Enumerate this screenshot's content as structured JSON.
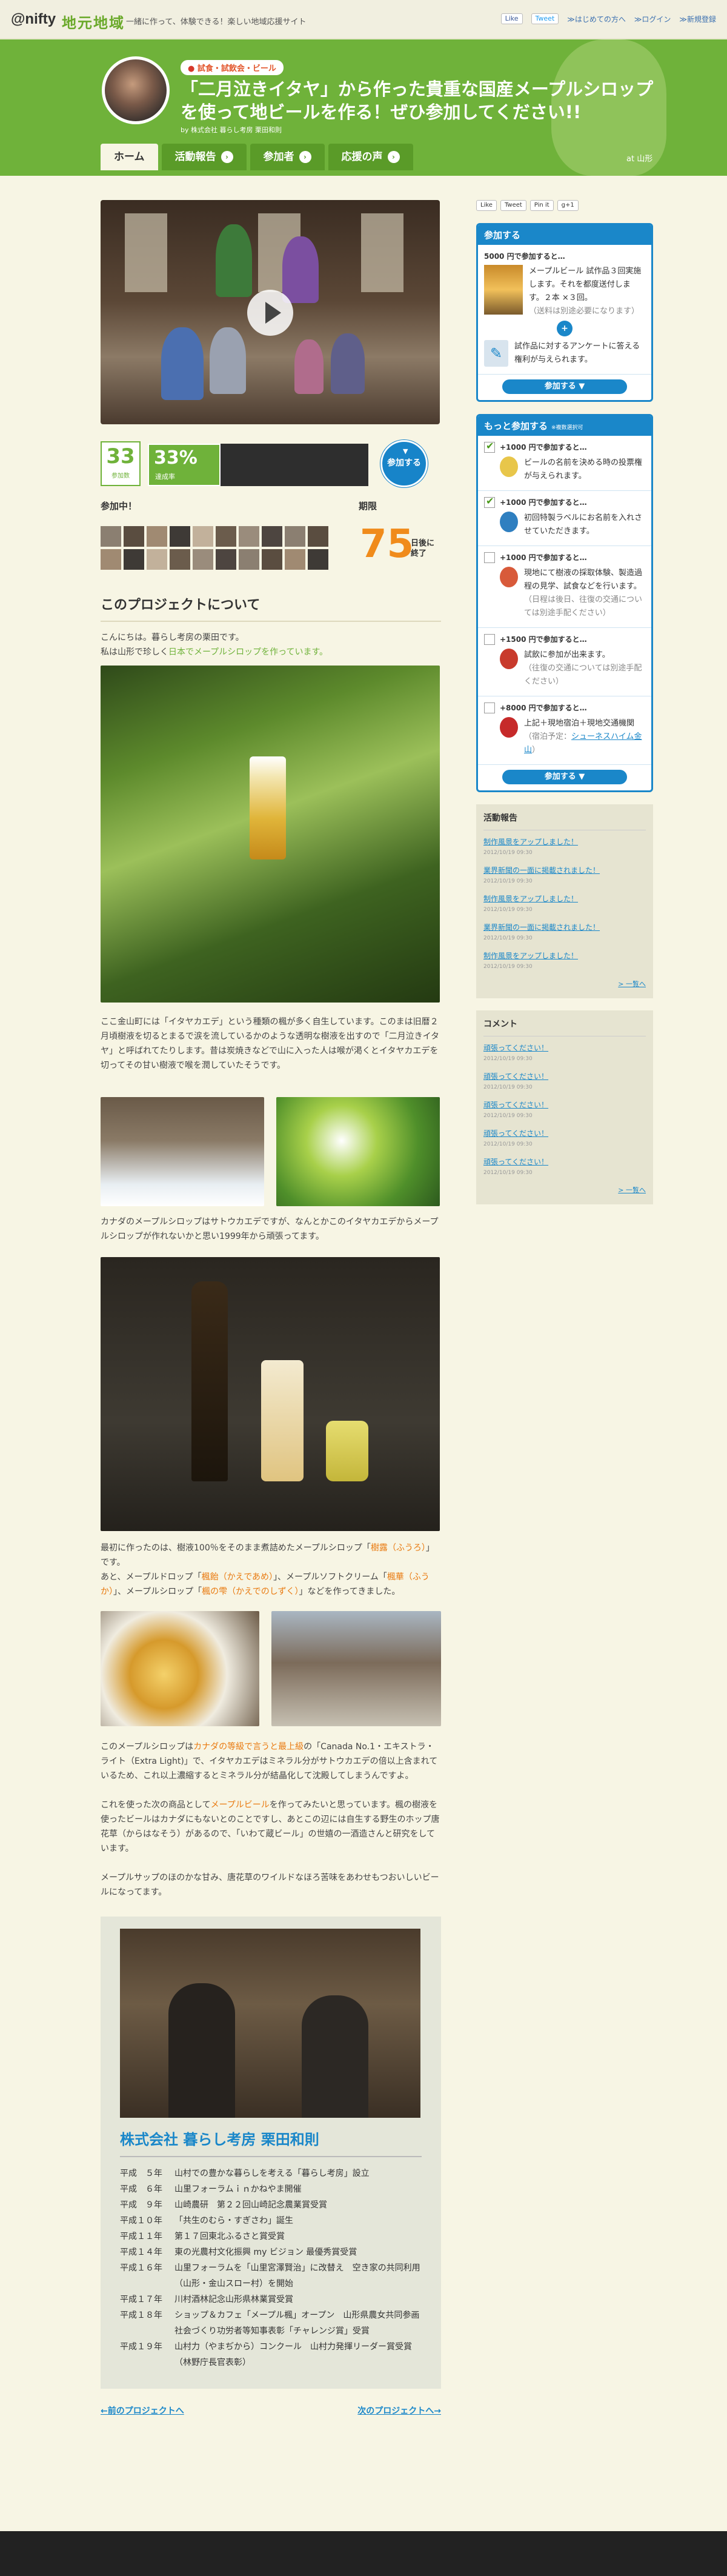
{
  "topbar": {
    "logo_nifty": "@nifty",
    "logo_jimoto": "地元地域",
    "tagline": "一緒に作って、体験できる！楽しい地域応援サイト",
    "fb_like": "Like",
    "tweet": "Tweet",
    "link_about": "≫はじめての方へ",
    "link_login": "≫ログイン",
    "link_signup": "≫新規登録"
  },
  "header": {
    "category": "試食・試飲会・ビール",
    "title": "「二月泣きイタヤ」から作った貴重な国産メープルシロップを使って地ビールを作る！ぜひ参加してください!!",
    "by": "by 株式会社 暮らし考房 栗田和則",
    "location": "at 山形",
    "tabs": [
      {
        "label": "ホーム"
      },
      {
        "label": "活動報告"
      },
      {
        "label": "参加者"
      },
      {
        "label": "応援の声"
      }
    ]
  },
  "stats": {
    "participants": "33",
    "participants_label": "参加数",
    "percent": "33%",
    "percent_value": 0.33,
    "percent_label": "達成率",
    "join_label": "参加する",
    "participating_label": "参加中！",
    "deadline_label": "期限",
    "days": "75",
    "days_label": "日後に終了"
  },
  "about": {
    "title": "このプロジェクトについて",
    "p1a": "こんにちは。暮らし考房の栗田です。",
    "p1b": "私は山形で珍しく",
    "p1c": "日本でメープルシロップを作っています。",
    "p2": "ここ金山町には「イタヤカエデ」という種類の楓が多く自生しています。このまは旧暦２月頃樹液を切るとまるで涙を流しているかのような透明な樹液を出すので「二月泣きイタヤ」と呼ばれてたりします。昔は炭焼きなどで山に入った人は喉が渇くとイタヤカエデを切ってその甘い樹液で喉を潤していたそうです。",
    "p3": "カナダのメープルシロップはサトウカエデですが、なんとかこのイタヤカエデからメープルシロップが作れないかと思い1999年から頑張ってます。",
    "p4a": "最初に作ったのは、樹液100％をそのまま煮詰めたメープルシロップ「",
    "p4b": "樹露（ふうろ）",
    "p4c": "」です。",
    "p4d": "あと、メープルドロップ「",
    "p4e": "楓飴（かえであめ）",
    "p4f": "」、メープルソフトクリーム「",
    "p4g": "楓華（ふうか）",
    "p4h": "」、メープルシロップ「",
    "p4i": "楓の雫（かえでのしずく）",
    "p4j": "」などを作ってきました。",
    "p5a": "このメープルシロップは",
    "p5b": "カナダの等級で言うと最上級",
    "p5c": "の「Canada No.1・エキストラ・ライト（Extra Light)」で、イタヤカエデはミネラル分がサトウカエデの倍以上含まれているため、これ以上濃縮するとミネラル分が結晶化して沈殿してしまうんですよ。",
    "p6a": "これを使った次の商品として",
    "p6b": "メープルビール",
    "p6c": "を作ってみたいと思っています。楓の樹液を使ったビールはカナダにもないとのことですし、あとこの辺には自生する野生のホップ唐花草（からはなそう）があるので、「いわて蔵ビール」の世嬉の一酒造さんと研究をしています。",
    "p7": "メープルサップのほのかな甘み、唐花草のワイルドなほろ苦味をあわせもつおいしいビールになってます。"
  },
  "bio": {
    "name": "株式会社 暮らし考房 栗田和則",
    "rows": [
      {
        "year": "平成　５年",
        "text": "山村での豊かな暮らしを考える「暮らし考房」設立"
      },
      {
        "year": "平成　６年",
        "text": "山里フォーラムｉｎかねやま開催"
      },
      {
        "year": "平成　９年",
        "text": "山崎農研　第２２回山崎記念農業賞受賞"
      },
      {
        "year": "平成１０年",
        "text": "「共生のむら・すぎさわ」誕生"
      },
      {
        "year": "平成１１年",
        "text": "第１７回東北ふるさと賞受賞"
      },
      {
        "year": "平成１４年",
        "text": "東の光農村文化振興 my ビジョン 最優秀賞受賞"
      },
      {
        "year": "平成１６年",
        "text": "山里フォーラムを「山里宮澤賢治」に改替え　空き家の共同利用（山形・金山スロー村）を開始"
      },
      {
        "year": "平成１７年",
        "text": "川村酒林記念山形県林業賞受賞"
      },
      {
        "year": "平成１８年",
        "text": "ショップ＆カフェ「メープル楓」オープン　山形県農女共同参画社会づくり功労者等知事表彰「チャレンジ賞」受賞"
      },
      {
        "year": "平成１９年",
        "text": "山村力（やまぢから）コンクール　山村力発揮リーダー賞受賞（林野庁長官表彰）"
      }
    ]
  },
  "pager": {
    "prev": "←前のプロジェクトへ",
    "next": "次のプロジェクトへ→"
  },
  "sidebar": {
    "share": [
      "Like",
      "Tweet",
      "Pin it",
      "g+1"
    ],
    "join_panel": {
      "title": "参加する",
      "reward_amount": "5000 円で参加すると…",
      "reward_text": "メープルビール 試作品３回実施します。それを都度送付します。２本 ×３回。",
      "reward_note": "（送料は別途必要になります）",
      "reward2_text": "試作品に対するアンケートに答える権利が与えられます。",
      "button": "参加する ▼"
    },
    "more_panel": {
      "title": "もっと参加する",
      "sub": "※複数選択可",
      "items": [
        {
          "amount": "+1000 円で参加すると…",
          "text": "ビールの名前を決める時の投票権が与えられます。",
          "note": "",
          "checked": true
        },
        {
          "amount": "+1000 円で参加すると…",
          "text": "初回特製ラベルにお名前を入れさせていただきます。",
          "note": "",
          "checked": true
        },
        {
          "amount": "+1000 円で参加すると…",
          "text": "現地にて樹液の採取体験、製造過程の見学、試食などを行います。",
          "note": "（日程は後日、往復の交通については別途手配ください）",
          "checked": false
        },
        {
          "amount": "+1500 円で参加すると…",
          "text": "試飲に参加が出来ます。",
          "note": "（往復の交通については別途手配ください）",
          "checked": false
        },
        {
          "amount": "+8000 円で参加すると…",
          "text": "上記＋現地宿泊＋現地交通機関",
          "note": "（宿泊予定：",
          "link": "シューネスハイム金山",
          "note_end": "）",
          "checked": false
        }
      ],
      "button": "参加する ▼"
    },
    "reports": {
      "title": "活動報告",
      "items": [
        {
          "text": "制作風景をアップしました！",
          "date": "2012/10/19 09:30"
        },
        {
          "text": "業界新聞の一面に掲載されました！",
          "date": "2012/10/19 09:30"
        },
        {
          "text": "制作風景をアップしました！",
          "date": "2012/10/19 09:30"
        },
        {
          "text": "業界新聞の一面に掲載されました！",
          "date": "2012/10/19 09:30"
        },
        {
          "text": "制作風景をアップしました！",
          "date": "2012/10/19 09:30"
        }
      ],
      "more": "> 一覧へ"
    },
    "comments": {
      "title": "コメント",
      "items": [
        {
          "text": "頑張ってください！",
          "date": "2012/10/19 09:30"
        },
        {
          "text": "頑張ってください！",
          "date": "2012/10/19 09:30"
        },
        {
          "text": "頑張ってください！",
          "date": "2012/10/19 09:30"
        },
        {
          "text": "頑張ってください！",
          "date": "2012/10/19 09:30"
        },
        {
          "text": "頑張ってください！",
          "date": "2012/10/19 09:30"
        }
      ],
      "more": "> 一覧へ"
    }
  },
  "colors": {
    "brand_green": "#6fb23a",
    "accent_blue": "#1a87c9",
    "accent_orange": "#f08b1b"
  }
}
